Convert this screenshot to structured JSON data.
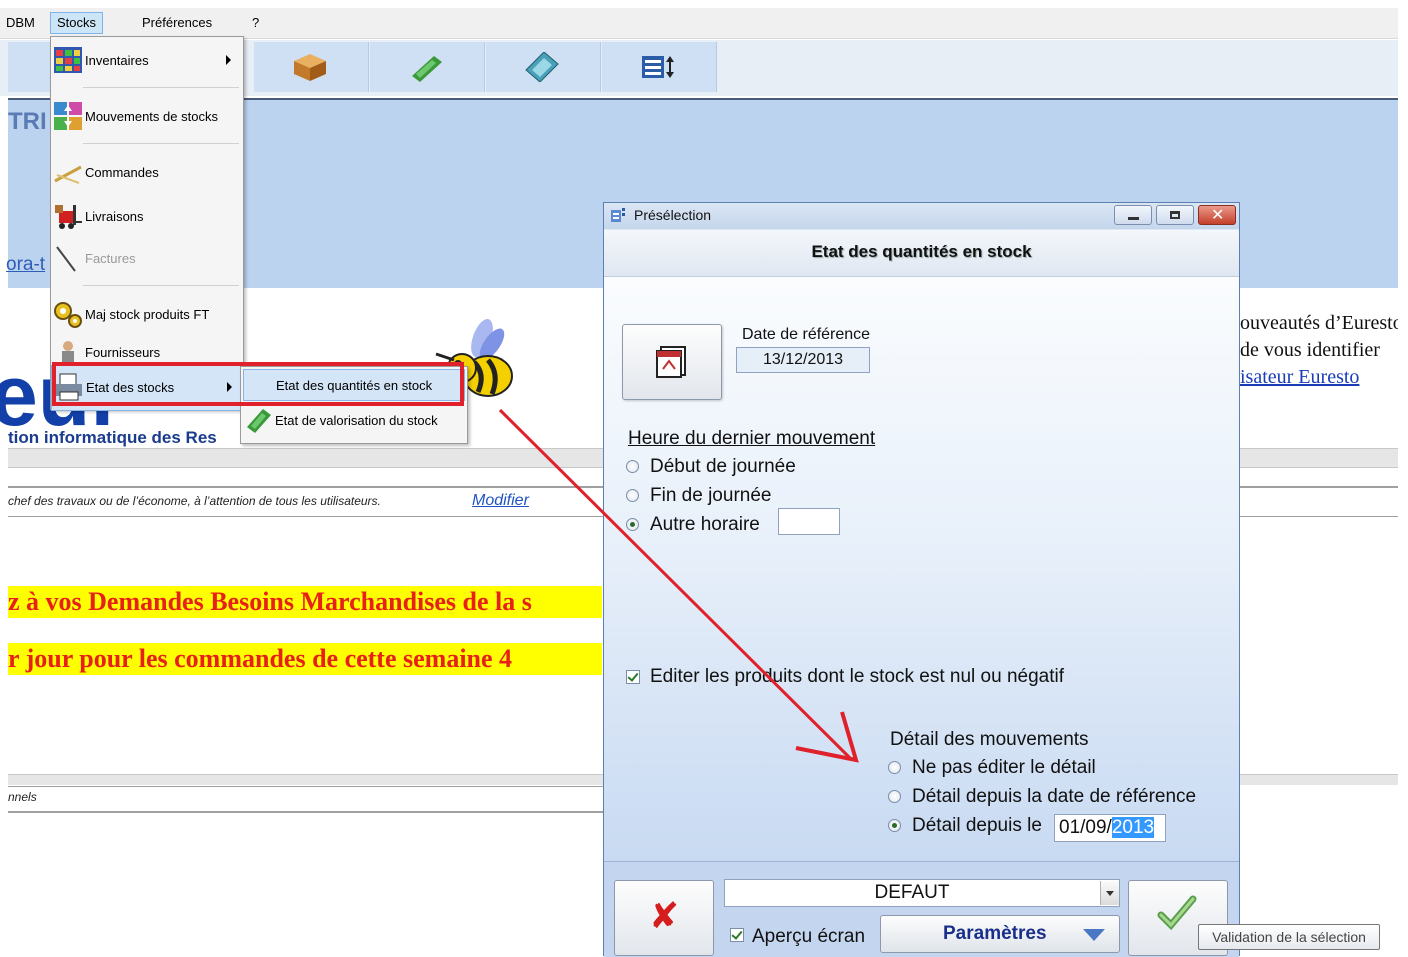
{
  "menubar": {
    "items": [
      "DBM",
      "Stocks",
      "Préférences",
      "?"
    ]
  },
  "banner": {
    "text": "TRI",
    "link": "ora-t"
  },
  "logo": {
    "tagline": "tion informatique des Res"
  },
  "info": {
    "note": "chef des travaux ou de l’économe, à l’attention de tous les utilisateurs.",
    "modifier": "Modifier"
  },
  "announcements": [
    "z à vos Demandes Besoins Marchandises de la s",
    "r jour pour les commandes de cette semaine 4"
  ],
  "footer_note": "nnels",
  "right_panel": {
    "line1": "ouveautés d’Euresto",
    "line2": "de vous identifier",
    "link": "isateur Euresto"
  },
  "stocks_menu": {
    "items": [
      {
        "label": "Inventaires",
        "icon": "inventory-icon",
        "submenu": true
      },
      {
        "label": "Mouvements de stocks",
        "icon": "stock-movements-icon"
      },
      {
        "label": "Commandes",
        "icon": "orders-icon"
      },
      {
        "label": "Livraisons",
        "icon": "forklift-icon"
      },
      {
        "label": "Factures",
        "icon": "invoice-icon",
        "disabled": true
      },
      {
        "label": "Maj stock produits FT",
        "icon": "gears-icon"
      },
      {
        "label": "Fournisseurs",
        "icon": "supplier-icon"
      },
      {
        "label": "Etat des stocks",
        "icon": "stock-report-icon",
        "submenu": true,
        "selected": true
      }
    ],
    "submenu": [
      {
        "label": "Etat des quantités en stock",
        "selected": true
      },
      {
        "label": "Etat de valorisation du stock",
        "icon": "money-icon"
      }
    ]
  },
  "dialog": {
    "title": "Présélection",
    "heading": "Etat des quantités en stock",
    "date_ref_label": "Date de référence",
    "date_ref_value": "13/12/2013",
    "heure_label": "Heure du dernier mouvement",
    "heure_options": [
      "Début de journée",
      "Fin de journée",
      "Autre horaire"
    ],
    "heure_selected": "Autre horaire",
    "autre_value": "",
    "editer_label": "Editer les produits dont le stock est nul ou négatif",
    "editer_checked": true,
    "detail_label": "Détail des mouvements",
    "detail_options": [
      "Ne pas éditer le détail",
      "Détail depuis la date de référence",
      "Détail depuis le"
    ],
    "detail_selected": "Détail depuis le",
    "detail_date_prefix": "01/09/",
    "detail_date_selected": "2013",
    "combo_value": "DEFAUT",
    "apercu_label": "Aperçu écran",
    "apercu_checked": true,
    "params_label": "Paramètres",
    "tooltip": "Validation de la sélection"
  },
  "colors": {
    "highlight": "#e0202a",
    "banner": "#bcd3ef",
    "announcement_bg": "#ffff00",
    "announcement_text": "#e8201a"
  }
}
